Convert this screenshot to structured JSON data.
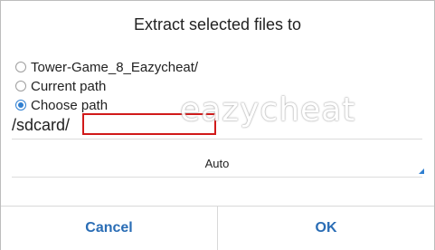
{
  "dialog": {
    "title": "Extract selected files to"
  },
  "options": [
    {
      "label": "Tower-Game_8_Eazycheat/",
      "checked": false
    },
    {
      "label": "Current path",
      "checked": false
    },
    {
      "label": "Choose path",
      "checked": true
    }
  ],
  "path": {
    "prefix": "/sdcard/",
    "value": ""
  },
  "encoding": {
    "selected": "Auto"
  },
  "buttons": {
    "cancel": "Cancel",
    "ok": "OK"
  },
  "watermark": {
    "text": "eazycheat"
  },
  "colors": {
    "accent": "#2f7fd1",
    "button_text": "#2a6db5",
    "highlight_border": "#d11a1a"
  }
}
